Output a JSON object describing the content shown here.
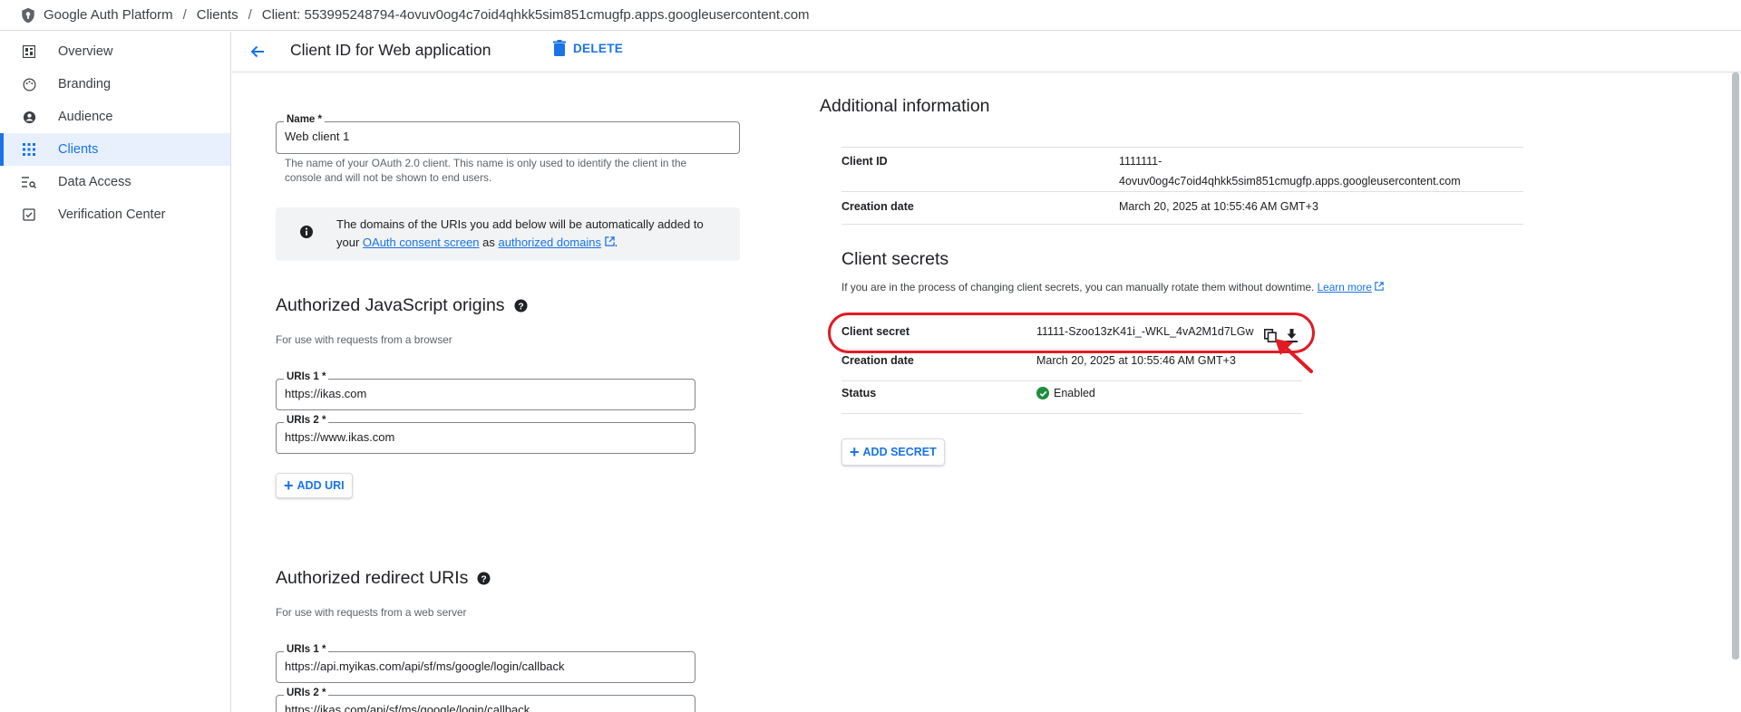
{
  "breadcrumb": {
    "app": "Google Auth Platform",
    "sep": "/",
    "section": "Clients",
    "client": "Client:  553995248794-4ovuv0og4c7oid4qhkk5sim851cmugfp.apps.googleusercontent.com"
  },
  "sidebar": {
    "items": [
      {
        "label": "Overview",
        "icon": "dashboard-icon"
      },
      {
        "label": "Branding",
        "icon": "palette-icon"
      },
      {
        "label": "Audience",
        "icon": "person-icon"
      },
      {
        "label": "Clients",
        "icon": "grid-icon",
        "active": true
      },
      {
        "label": "Data Access",
        "icon": "data-access-icon"
      },
      {
        "label": "Verification Center",
        "icon": "verification-icon"
      }
    ]
  },
  "header": {
    "title": "Client ID for Web application",
    "delete_label": "DELETE"
  },
  "form": {
    "name": {
      "label": "Name *",
      "value": "Web client 1"
    },
    "name_hint": "The name of your OAuth 2.0 client. This name is only used to identify the client in the console and will not be shown to end users.",
    "info": {
      "text_before": "The domains of the URIs you add below will be automatically added to your ",
      "link1": "OAuth consent screen",
      "text_mid": " as ",
      "link2": "authorized domains",
      "text_after": "."
    },
    "js_origins": {
      "title": "Authorized JavaScript origins",
      "subtitle": "For use with requests from a browser",
      "uris": [
        {
          "label": "URIs 1 *",
          "value": "https://ikas.com"
        },
        {
          "label": "URIs 2 *",
          "value": "https://www.ikas.com"
        }
      ],
      "add_label": "ADD URI"
    },
    "redirect_uris": {
      "title": "Authorized redirect URIs",
      "subtitle": "For use with requests from a web server",
      "uris": [
        {
          "label": "URIs 1 *",
          "value": "https://api.myikas.com/api/sf/ms/google/login/callback"
        },
        {
          "label": "URIs 2 *",
          "value": "https://ikas.com/api/sf/ms/google/login/callback"
        }
      ]
    }
  },
  "additional": {
    "title": "Additional information",
    "client_id_key": "Client ID",
    "client_id_line1": "1111111-",
    "client_id_line2": "4ovuv0og4c7oid4qhkk5sim851cmugfp.apps.googleusercontent.com",
    "creation_key": "Creation date",
    "creation_value": "March 20, 2025 at 10:55:46 AM GMT+3"
  },
  "secrets": {
    "title": "Client secrets",
    "desc": "If you are in the process of changing client secrets, you can manually rotate them without downtime. ",
    "learn_more": "Learn more",
    "secret_key": "Client secret",
    "secret_value": "11111-Szoo13zK41i_-WKL_4vA2M1d7LGw",
    "creation_key": "Creation date",
    "creation_value": "March 20, 2025 at 10:55:46 AM GMT+3",
    "status_key": "Status",
    "status_value": "Enabled",
    "add_label": "ADD SECRET"
  },
  "colors": {
    "accent": "#1a73e8",
    "highlight": "#e01b24",
    "success": "#1e8e3e"
  }
}
